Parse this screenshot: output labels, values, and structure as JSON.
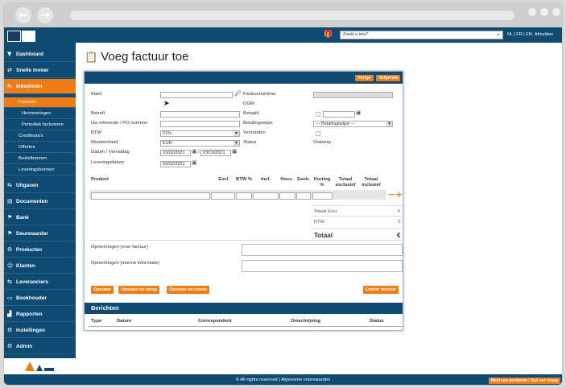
{
  "page": {
    "title": "Voeg factuur toe"
  },
  "topbar": {
    "search_placeholder": "Zoekt u iets?",
    "languages": "NL | FR | EN",
    "logout": "Afmelden"
  },
  "sidebar": {
    "items": [
      {
        "label": "Dashboard"
      },
      {
        "label": "Snelle invoer"
      },
      {
        "label": "Inkomsten"
      },
      {
        "label": "Uitgaven"
      },
      {
        "label": "Documenten"
      },
      {
        "label": "Bank"
      },
      {
        "label": "Deurwaarder"
      },
      {
        "label": "Producten"
      },
      {
        "label": "Klanten"
      },
      {
        "label": "Leveranciers"
      },
      {
        "label": "Boekhouder"
      },
      {
        "label": "Rapporten"
      },
      {
        "label": "Instellingen"
      },
      {
        "label": "Admin"
      }
    ],
    "subitems": [
      {
        "label": "Facturen"
      },
      {
        "label": "Herinneringen"
      },
      {
        "label": "Periodiek factureren"
      },
      {
        "label": "Creditnota's"
      },
      {
        "label": "Offertes"
      },
      {
        "label": "Bestelbonnen"
      },
      {
        "label": "Leveringsbonnen"
      }
    ]
  },
  "panel": {
    "prev": "Vorige",
    "next": "Volgende",
    "left_labels": {
      "klant": "Klant",
      "betreft": "Betreft",
      "referentie": "Uw referentie / PO nummer",
      "btw": "BTW",
      "munteenheid": "Munteenheid",
      "datum": "Datum / Verval­dag",
      "levering": "Leveringsdatum"
    },
    "btw_value": "21%",
    "currency_value": "EUR",
    "date_value": "03/02/2021",
    "due_value": "03/03/2021",
    "delivery_value": "03/02/2021",
    "date_separator": "/",
    "right_labels": {
      "factuurnummer": "Factuurnummer",
      "ogm": "OGM",
      "betaald": "Betaald",
      "betalingswijze": "Betalingswijze",
      "verzonden": "Verzonden",
      "status": "Status"
    },
    "payment_method": "--- Betalingswijze ---",
    "status_value": "Ontwerp",
    "table_headers": {
      "product": "Product",
      "excl": "Excl.",
      "btw": "BTW %",
      "incl": "Incl.",
      "hoev": "Hoev.",
      "eenh": "Eenh.",
      "korting": "Korting %",
      "totaal_excl": "Totaal exclusief",
      "totaal_incl": "Totaal inclusief"
    },
    "totals": {
      "excl_label": "Totaal Excl.",
      "btw_label": "BTW",
      "totaal_label": "Totaal",
      "currency": "€"
    },
    "remarks_invoice": "Opmerkingen (over factuur)",
    "remarks_internal": "Opmerkingen (interne informatie)",
    "buttons": {
      "save": "Opslaan",
      "save_back": "Opslaan en terug",
      "save_new": "Opslaan en nieuw",
      "create": "Creëer factuur"
    },
    "messages": {
      "title": "Berichten",
      "headers": [
        "Type",
        "Datum",
        "Correspondent",
        "Omschrijving",
        "Status"
      ]
    }
  },
  "footer": {
    "text": "© All rights reserved | Algemene voorwaarden",
    "report": "Meld een probleem / Stel een vraag"
  }
}
